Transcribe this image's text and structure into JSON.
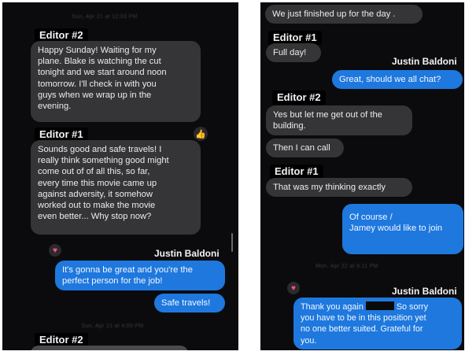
{
  "left": {
    "timestamp_top": "Sun, Apr 21 at 12:03 PM",
    "editor2_label": "Editor #2",
    "msg1": "Happy Sunday! Waiting for my\nplane. Blake is watching the cut\ntonight and we start around noon\ntomorrow. I'll check in with you\nguys when we wrap up in the\nevening.",
    "editor1_label": "Editor #1",
    "thumb_reaction": "👍",
    "msg2": "Sounds good and safe travels! I\nreally think something good might\ncome out of of all this, so far,\nevery time this movie came up\nagainst adversity, it somehow\nworked out to make the movie\neven better... Why stop now?",
    "justin_label": "Justin Baldoni",
    "heart_reaction": "♥",
    "msg3": "It's gonna be great and you're the\nperfect person for the job!",
    "msg4": "Safe travels!",
    "timestamp_bottom": "Sun, Apr 21 at 4:00 PM",
    "editor2_label_bottom": "Editor #2"
  },
  "right": {
    "msg_top": "We just finished up for the day .",
    "editor1_label": "Editor #1",
    "msg_full_day": "Full day!",
    "justin_label": "Justin Baldoni",
    "msg_great": "Great, should we all chat?",
    "editor2_label": "Editor #2",
    "msg_yes": "Yes but let me get out of the\nbuilding.",
    "msg_then": "Then I can call",
    "editor1_label_2": "Editor #1",
    "msg_thinking": "That was my thinking exactly",
    "msg_ofcourse": "Of course /\nJamey would like to join",
    "timestamp": "Mon, Apr 22 at 9:11 PM",
    "justin_label_2": "Justin Baldoni",
    "heart_reaction": "♥",
    "msg_thanks_start": "Thank you again ",
    "msg_thanks_end": " So sorry\nyou have to be in this position yet\nno one better suited. Grateful for\nyou."
  }
}
